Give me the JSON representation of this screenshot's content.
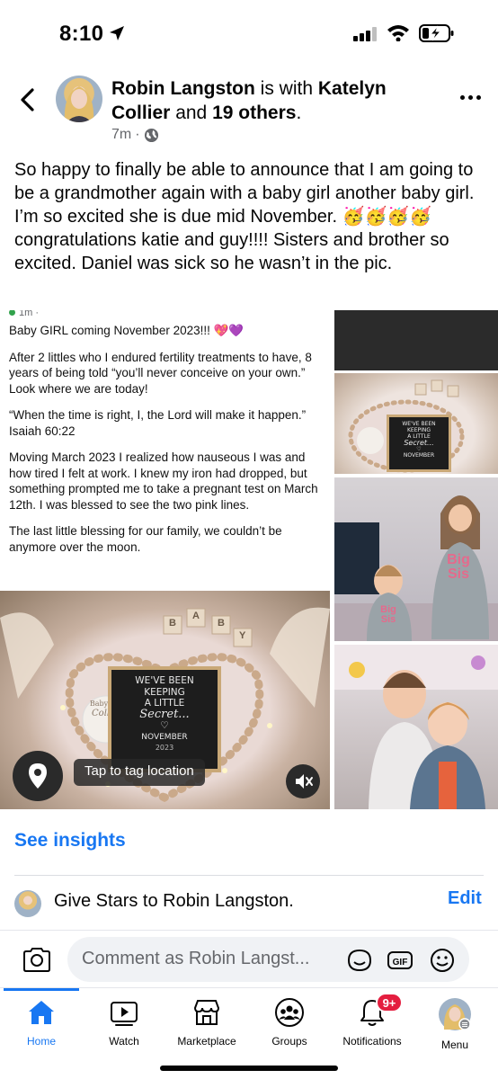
{
  "status_bar": {
    "time": "8:10"
  },
  "post": {
    "author": "Robin Langston",
    "with_word": "is with",
    "tagged_person": "Katelyn Collier",
    "and_word": "and",
    "others": "19 others",
    "period": ".",
    "time_ago": "7m",
    "separator": "·",
    "text_lines": [
      "So happy to finally be able to announce that I am going to be a grandmother again with a baby girl another baby girl.",
      "I’m so excited she is due mid November. 🥳🥳🥳🥳 congratulations katie and guy!!!! Sisters and brother so excited. Daniel was sick so he wasn’t in the pic."
    ]
  },
  "shared_post": {
    "meta": "1m ·",
    "paragraphs": [
      "Baby GIRL coming November 2023!!! 💖💜",
      "After 2 littles who I endured fertility treatments to have, 8 years of being told “you’ll never conceive on your own.” Look where we are today!",
      "“When the time is right, I, the Lord will make it happen.” Isaiah 60:22",
      "Moving March 2023 I realized how nauseous I was and how tired I felt at work. I knew my iron had dropped, but something prompted me to take a pregnant test on March 12th. I was blessed to see the two pink lines.",
      "The last little blessing for our family, we couldn’t be anymore over the moon."
    ]
  },
  "photo": {
    "board_lines": [
      "WE'VE BEEN",
      "KEEPING",
      "A LITTLE",
      "Secret...",
      "♡",
      "NOVEMBER",
      "2023"
    ],
    "plate_lines": [
      "Baby Girl",
      "Collier"
    ],
    "blocks": [
      "B",
      "A",
      "B",
      "Y"
    ],
    "shirt_text": [
      "Big",
      "Sis"
    ]
  },
  "overlay": {
    "tag_location": "Tap to tag location"
  },
  "actions": {
    "see_insights": "See insights",
    "give_stars": "Give Stars to Robin Langston.",
    "edit": "Edit"
  },
  "comment": {
    "placeholder": "Comment as Robin Langst..."
  },
  "tabs": [
    {
      "label": "Home",
      "icon": "home-icon"
    },
    {
      "label": "Watch",
      "icon": "watch-icon"
    },
    {
      "label": "Marketplace",
      "icon": "marketplace-icon"
    },
    {
      "label": "Groups",
      "icon": "groups-icon"
    },
    {
      "label": "Notifications",
      "icon": "bell-icon",
      "badge": "9+"
    },
    {
      "label": "Menu",
      "icon": "avatar-icon"
    }
  ],
  "colors": {
    "accent": "#1877f2",
    "badge": "#e41e3f",
    "muted": "#65676b"
  }
}
